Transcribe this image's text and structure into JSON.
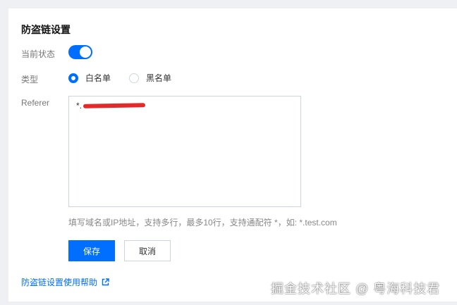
{
  "page": {
    "title": "防盗链设置"
  },
  "status": {
    "label": "当前状态",
    "enabled": true
  },
  "type": {
    "label": "类型",
    "options": [
      {
        "label": "白名单",
        "selected": true
      },
      {
        "label": "黑名单",
        "selected": false
      }
    ]
  },
  "referer": {
    "label": "Referer",
    "value_prefix": "*.",
    "hint": "填写域名或IP地址，支持多行，最多10行，支持通配符 *，如: *.test.com"
  },
  "buttons": {
    "save": "保存",
    "cancel": "取消"
  },
  "help": {
    "link_text": "防盗链设置使用帮助",
    "icon": "external-link-icon"
  },
  "watermark": "掘金技术社区 @ 粤海科技君",
  "colors": {
    "accent": "#006eff",
    "redaction": "#e32a2a",
    "border": "#cfd5de"
  }
}
